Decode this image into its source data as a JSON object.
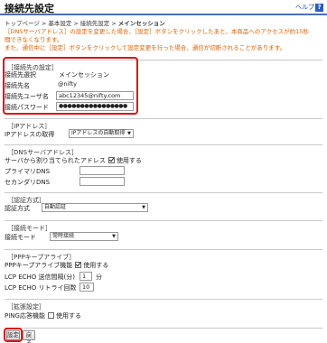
{
  "header": {
    "title": "接続先設定",
    "help_label": "ヘルプ",
    "help_icon": "?"
  },
  "breadcrumb": {
    "items": [
      "トップページ",
      "基本設定",
      "接続先設定",
      "メインセッション"
    ],
    "separator": ">"
  },
  "warning": {
    "line1": "［DNSサーバアドレス］の設定を変更した場合、［設定］ボタンをクリックしたあと、本商品へのアクセスが約15秒",
    "line2": "間できなくなります。",
    "line3": "また、通信中に［設定］ボタンをクリックして設定変更を行った場合、通信が切断されることがあります。"
  },
  "connection": {
    "title": "［接続先の設定］",
    "select_label": "接続先選択",
    "select_value": "メインセッション",
    "name_label": "接続先名",
    "name_value": "@nifty",
    "user_label": "接続先ユーザ名",
    "user_value": "abc12345@nifty.com",
    "password_label": "接続パスワード",
    "password_value": "●●●●●●●●●●●●●●●●"
  },
  "ip": {
    "title": "［IPアドレス］",
    "label": "IPアドレスの取得",
    "value": "IPアドレスの自動取得"
  },
  "dns": {
    "title": "［DNSサーバアドレス］",
    "auto_label": "サーバから割り当てられたアドレス",
    "auto_check_label": "使用する",
    "primary_label": "プライマリDNS",
    "secondary_label": "セカンダリDNS"
  },
  "auth": {
    "title": "［認証方式］",
    "label": "認証方式",
    "value": "自動認証"
  },
  "mode": {
    "title": "［接続モード］",
    "label": "接続モード",
    "value": "常時接続"
  },
  "ppp": {
    "title": "［PPPキープアライブ］",
    "keepalive_label": "PPPキープアライブ機能",
    "keepalive_check_label": "使用する",
    "interval_label": "LCP ECHO 送信間隔(分)",
    "interval_value": "1",
    "interval_unit": "分",
    "retry_label": "LCP ECHO リトライ回数",
    "retry_value": "10"
  },
  "ext": {
    "title": "［拡張設定］",
    "ping_label": "PING応答機能",
    "ping_check_label": "使用する"
  },
  "buttons": {
    "submit": "設定",
    "back": "戻る"
  }
}
